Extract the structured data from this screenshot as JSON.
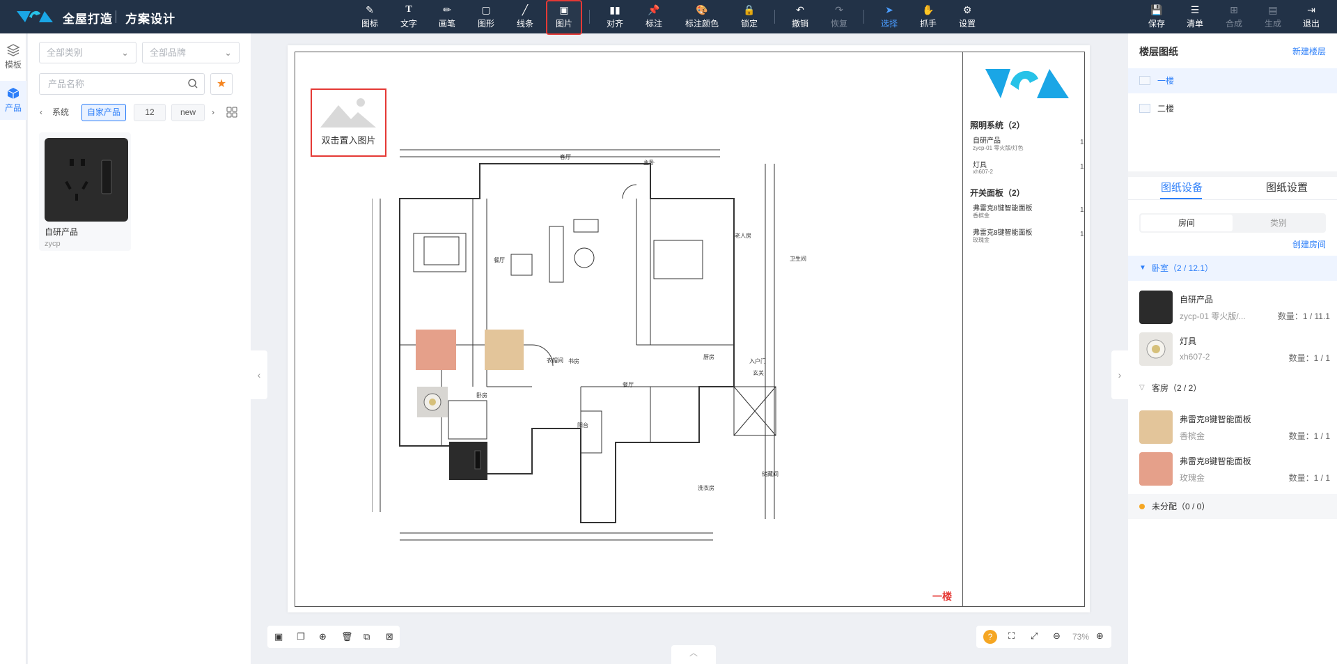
{
  "header": {
    "brand": "全屋打造",
    "subtitle": "方案设计",
    "tools": [
      {
        "label": "图标",
        "icon": "icon-tool-icon"
      },
      {
        "label": "文字",
        "icon": "text-tool-icon"
      },
      {
        "label": "画笔",
        "icon": "brush-tool-icon"
      },
      {
        "label": "图形",
        "icon": "shape-tool-icon"
      },
      {
        "label": "线条",
        "icon": "line-tool-icon"
      },
      {
        "label": "图片",
        "icon": "image-tool-icon"
      },
      {
        "label": "对齐",
        "icon": "align-tool-icon"
      },
      {
        "label": "标注",
        "icon": "pin-tool-icon"
      },
      {
        "label": "标注颜色",
        "icon": "palette-tool-icon"
      },
      {
        "label": "锁定",
        "icon": "lock-tool-icon"
      },
      {
        "label": "撤销",
        "icon": "undo-icon"
      },
      {
        "label": "恢复",
        "icon": "redo-icon"
      },
      {
        "label": "选择",
        "icon": "select-cursor-icon"
      },
      {
        "label": "抓手",
        "icon": "hand-icon"
      },
      {
        "label": "设置",
        "icon": "gear-icon"
      }
    ],
    "actions": [
      {
        "label": "保存",
        "icon": "save-icon"
      },
      {
        "label": "清单",
        "icon": "list-icon"
      },
      {
        "label": "合成",
        "icon": "merge-icon"
      },
      {
        "label": "生成",
        "icon": "generate-icon"
      },
      {
        "label": "退出",
        "icon": "exit-icon"
      }
    ]
  },
  "rail": {
    "template": "模板",
    "product": "产品"
  },
  "left_panel": {
    "category_placeholder": "全部类别",
    "brand_placeholder": "全部品牌",
    "search_placeholder": "产品名称",
    "chips": [
      "系统",
      "自家产品",
      "12",
      "new"
    ],
    "chips_prefix": "‹",
    "chips_suffix": "›",
    "product": {
      "name": "自研产品",
      "sku": "zycp"
    }
  },
  "canvas": {
    "image_placeholder": "双击置入图片",
    "floor_tag": "一楼",
    "legend": {
      "groups": [
        {
          "title": "照明系统（2）",
          "items": [
            {
              "name": "自研产品",
              "sub": "zycp-01 零火版/灯色",
              "qty": "1"
            },
            {
              "name": "灯具",
              "sub": "xh607-2",
              "qty": "1"
            }
          ]
        },
        {
          "title": "开关面板（2）",
          "items": [
            {
              "name": "弗雷克8键智能面板",
              "sub": "香槟金",
              "qty": "1"
            },
            {
              "name": "弗雷克8键智能面板",
              "sub": "玫瑰金",
              "qty": "1"
            }
          ]
        }
      ]
    },
    "plan_labels": [
      "主卧",
      "客厅",
      "卧房",
      "老人房",
      "餐厅",
      "厨房",
      "入户门",
      "玄关",
      "卫生间",
      "衣帽间",
      "书房",
      "阳台",
      "储藏间",
      "洗衣房"
    ],
    "zoom": "73%"
  },
  "right_panel": {
    "title": "楼层图纸",
    "new_floor": "新建楼层",
    "floors": [
      "一楼",
      "二楼"
    ],
    "tabs": [
      "图纸设备",
      "图纸设置"
    ],
    "segments": [
      "房间",
      "类别"
    ],
    "create_room": "创建房间",
    "rooms": [
      {
        "name": "卧室（2 / 12.1）",
        "items": [
          {
            "name": "自研产品",
            "sub": "zycp-01 零火版/...",
            "qty": "数量：1 / 11.1",
            "color": "#2b2b2b"
          },
          {
            "name": "灯具",
            "sub": "xh607-2",
            "qty": "数量：1 / 1",
            "color": "#e8e6e2"
          }
        ]
      },
      {
        "name": "客房（2 / 2）",
        "items": [
          {
            "name": "弗雷克8键智能面板",
            "sub": "香槟金",
            "qty": "数量：1 / 1",
            "color": "#e3c59a"
          },
          {
            "name": "弗雷克8键智能面板",
            "sub": "玫瑰金",
            "qty": "数量：1 / 1",
            "color": "#e5a08a"
          }
        ]
      }
    ],
    "unassigned": "未分配（0 / 0）"
  },
  "colors": {
    "header_bg": "#223247",
    "accent": "#2d7ff9",
    "highlight": "#e53935",
    "logo": "#1aa6e6"
  }
}
